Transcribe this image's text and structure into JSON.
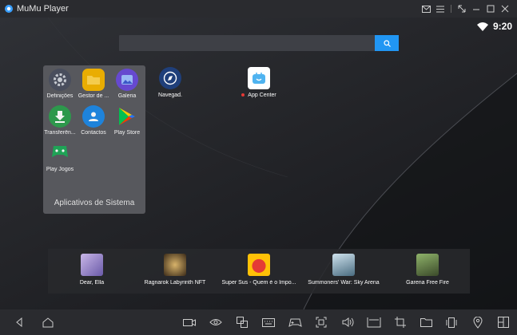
{
  "window": {
    "title": "MuMu Player",
    "accent": "#2196f3"
  },
  "status": {
    "time": "9:20"
  },
  "search": {
    "placeholder": ""
  },
  "folder": {
    "title": "Aplicativos de Sistema",
    "apps": [
      {
        "label": "Definições",
        "icon": "gear-icon"
      },
      {
        "label": "Gestor de ...",
        "icon": "folder-icon"
      },
      {
        "label": "Galeria",
        "icon": "gallery-icon"
      },
      {
        "label": "Transferên...",
        "icon": "download-icon"
      },
      {
        "label": "Contactos",
        "icon": "contacts-icon"
      },
      {
        "label": "Play Store",
        "icon": "play-store-icon"
      },
      {
        "label": "Play Jogos",
        "icon": "play-games-icon"
      }
    ]
  },
  "desktop": {
    "browser_label": "Navegad.",
    "app_center_label": "App Center"
  },
  "dock": {
    "games": [
      {
        "label": "Dear, Ella"
      },
      {
        "label": "Ragnarok Labyrinth NFT"
      },
      {
        "label": "Super Sus - Quem é o Impo..."
      },
      {
        "label": "Summoners' War: Sky Arena"
      },
      {
        "label": "Garena Free Fire"
      }
    ]
  }
}
